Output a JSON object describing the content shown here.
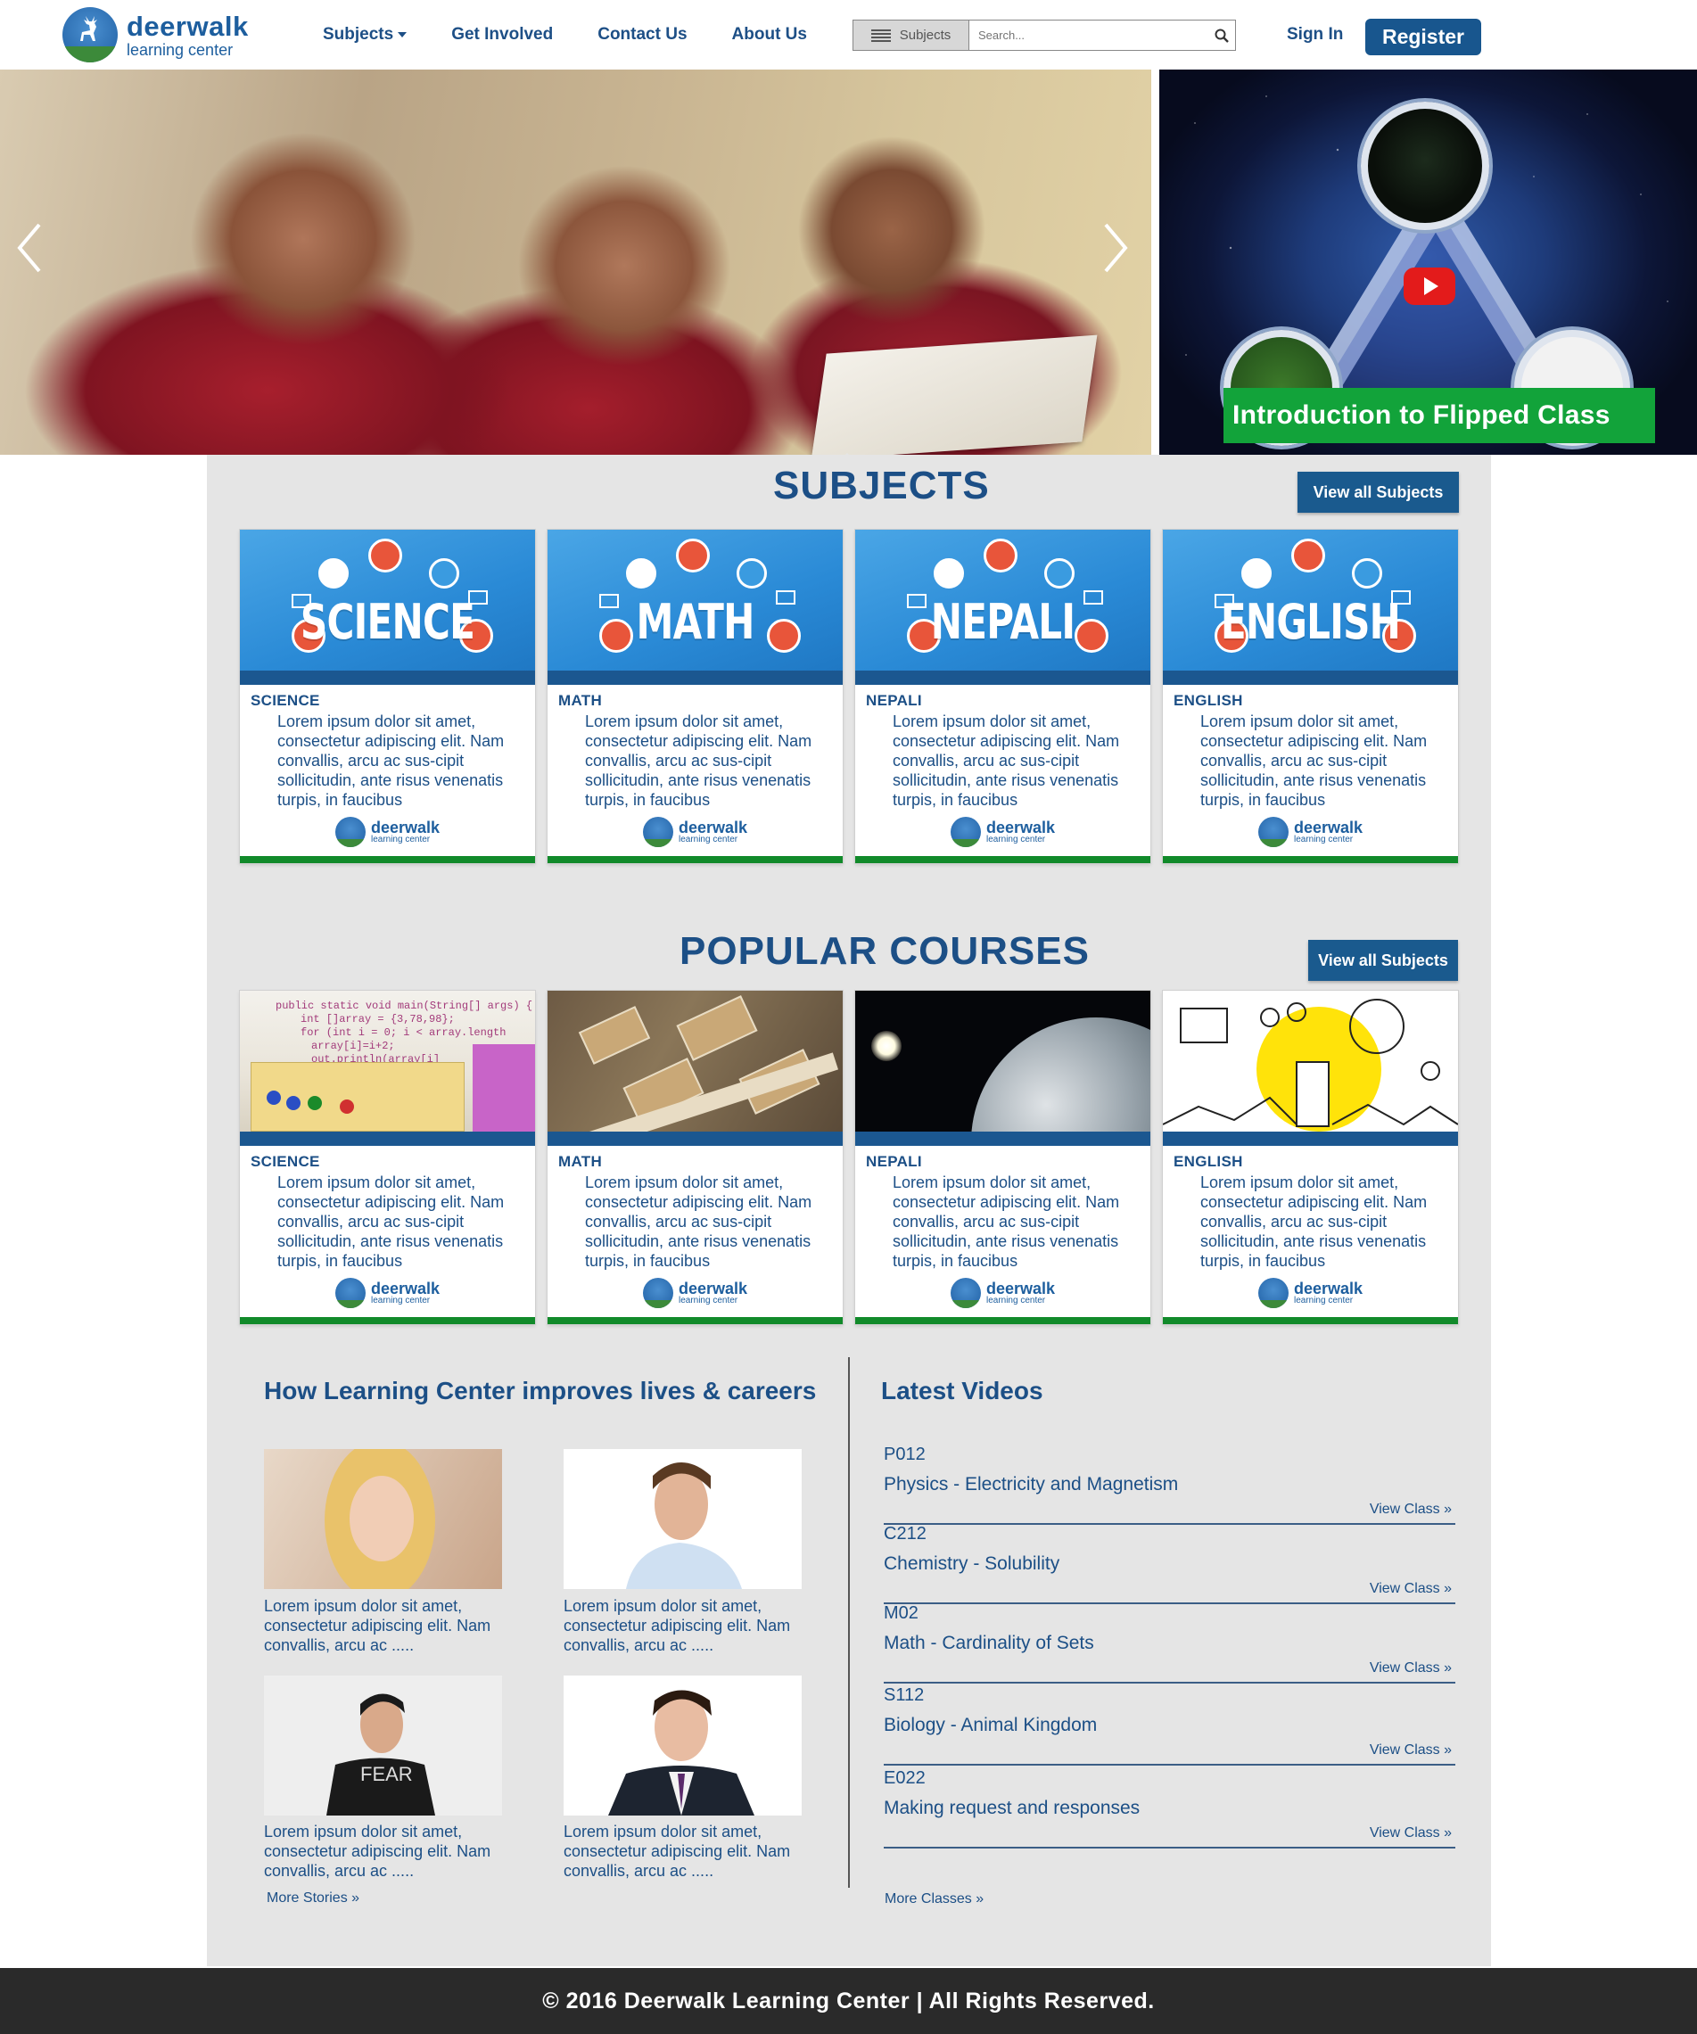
{
  "brand": {
    "name": "deerwalk",
    "tagline": "learning center"
  },
  "nav": {
    "subjects": "Subjects",
    "get_involved": "Get Involved",
    "contact": "Contact Us",
    "about": "About Us"
  },
  "search": {
    "category": "Subjects",
    "placeholder": "Search..."
  },
  "auth": {
    "sign_in": "Sign In",
    "register": "Register"
  },
  "hero": {
    "video_title": "Introduction to Flipped Class"
  },
  "subjects": {
    "title": "SUBJECTS",
    "view_all": "View all Subjects",
    "cards": [
      {
        "banner": "SCIENCE",
        "category": "SCIENCE",
        "text": "Lorem ipsum dolor sit amet, consectetur adipiscing elit. Nam convallis, arcu ac sus-cipit sollicitudin, ante risus venenatis turpis, in faucibus"
      },
      {
        "banner": "MATH",
        "category": "MATH",
        "text": "Lorem ipsum dolor sit amet, consectetur adipiscing elit. Nam convallis, arcu ac sus-cipit sollicitudin, ante risus venenatis turpis, in faucibus"
      },
      {
        "banner": "NEPALI",
        "category": "NEPALI",
        "text": "Lorem ipsum dolor sit amet, consectetur adipiscing elit. Nam convallis, arcu ac sus-cipit sollicitudin, ante risus venenatis turpis, in faucibus"
      },
      {
        "banner": "ENGLISH",
        "category": "ENGLISH",
        "text": "Lorem ipsum dolor sit amet, consectetur adipiscing elit. Nam convallis, arcu ac sus-cipit sollicitudin, ante risus venenatis turpis, in faucibus"
      }
    ]
  },
  "courses": {
    "title": "POPULAR COURSES",
    "view_all": "View all Subjects",
    "code_lines": [
      "public static void main(String[] args) {",
      "  int []array = {3,78,98};",
      "  for (int i = 0; i < array.length",
      "      array[i]=i+2;",
      "        out.println(array[i]"
    ],
    "cards": [
      {
        "category": "SCIENCE",
        "text": "Lorem ipsum dolor sit amet, consectetur adipiscing elit. Nam convallis, arcu ac sus-cipit sollicitudin, ante risus venenatis turpis, in faucibus"
      },
      {
        "category": "MATH",
        "text": "Lorem ipsum dolor sit amet, consectetur adipiscing elit. Nam convallis, arcu ac sus-cipit sollicitudin, ante risus venenatis turpis, in faucibus"
      },
      {
        "category": "NEPALI",
        "text": "Lorem ipsum dolor sit amet, consectetur adipiscing elit. Nam convallis, arcu ac sus-cipit sollicitudin, ante risus venenatis turpis, in faucibus"
      },
      {
        "category": "ENGLISH",
        "text": "Lorem ipsum dolor sit amet, consectetur adipiscing elit. Nam convallis, arcu ac sus-cipit sollicitudin, ante risus venenatis turpis, in faucibus"
      }
    ]
  },
  "stories": {
    "title": "How Learning Center improves lives & careers",
    "items": [
      {
        "text": "Lorem ipsum dolor sit amet, consectetur adipiscing elit. Nam convallis, arcu ac ....."
      },
      {
        "text": "Lorem ipsum dolor sit amet, consectetur adipiscing elit. Nam convallis, arcu ac ....."
      },
      {
        "text": "Lorem ipsum dolor sit amet, consectetur adipiscing elit. Nam convallis, arcu ac ....."
      },
      {
        "text": "Lorem ipsum dolor sit amet, consectetur adipiscing elit. Nam convallis, arcu ac ....."
      }
    ],
    "tshirt_text": "FEAR",
    "more": "More Stories »"
  },
  "videos": {
    "title": "Latest Videos",
    "items": [
      {
        "code": "P012",
        "title": "Physics - Electricity and Magnetism",
        "link": "View Class »"
      },
      {
        "code": "C212",
        "title": "Chemistry - Solubility",
        "link": "View Class »"
      },
      {
        "code": "M02",
        "title": "Math - Cardinality of Sets",
        "link": "View Class »"
      },
      {
        "code": "S112",
        "title": "Biology - Animal Kingdom",
        "link": "View Class »"
      },
      {
        "code": "E022",
        "title": "Making request and responses",
        "link": "View Class »"
      }
    ],
    "more": "More Classes »"
  },
  "footer": {
    "text": "© 2016 Deerwalk Learning Center  |  All Rights Reserved."
  },
  "colors": {
    "primary": "#1c4f86",
    "button": "#18568e",
    "accent_green": "#118a2a",
    "panel": "#e5e5e5",
    "footer": "#2a2a2a"
  }
}
